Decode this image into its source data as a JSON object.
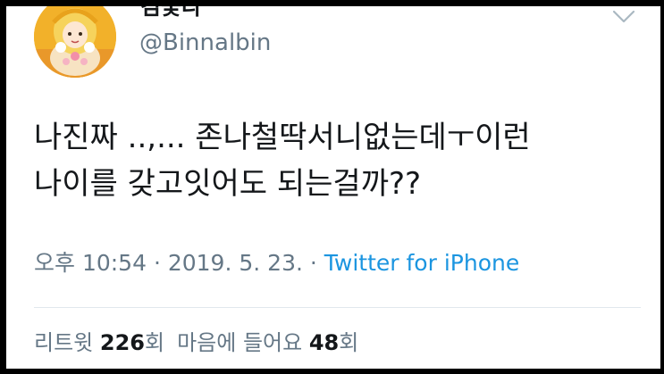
{
  "tweet": {
    "display_name": "김꽃다",
    "handle": "@Binnalbin",
    "text_lines": [
      "나진짜 ..,... 존나철딱서니없는데ㅜ이런",
      "나이를 갖고잇어도 되는걸까??"
    ],
    "meta": {
      "time": "오후 10:54",
      "separator": " · ",
      "date": "2019. 5. 23.",
      "source": "Twitter for iPhone"
    },
    "stats": {
      "retweets_label": "리트윗",
      "retweets_count": "226",
      "retweets_unit": "회",
      "likes_label": "마음에 들어요",
      "likes_count": "48",
      "likes_unit": "회"
    }
  },
  "icons": {
    "caret": "chevron-down-icon",
    "avatar": "cartoon-girl-avatar"
  },
  "colors": {
    "text": "#14171a",
    "secondary": "#657786",
    "link": "#1b95e0",
    "divider": "#e1e8ed",
    "background": "#ffffff"
  }
}
